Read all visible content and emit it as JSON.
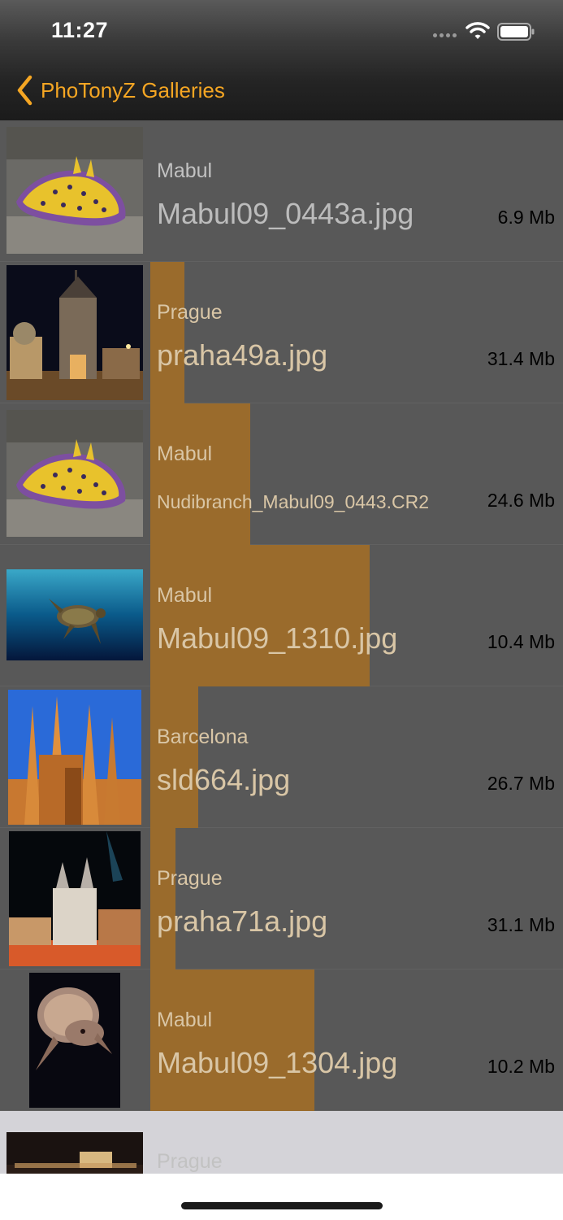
{
  "status_bar": {
    "time": "11:27"
  },
  "nav": {
    "back_label": "PhoTonyZ Galleries"
  },
  "colors": {
    "accent": "#f5a623",
    "bar": "#9a6b2c",
    "row_bg": "#585858",
    "selected_row_bg": "#d4d3d8"
  },
  "rows": [
    {
      "gallery": "Mabul",
      "filename": "Mabul09_0443a.jpg",
      "size": "6.9 Mb",
      "thumb": "nudibranch"
    },
    {
      "gallery": "Prague",
      "filename": "praha49a.jpg",
      "size": "31.4 Mb",
      "thumb": "prague-tower"
    },
    {
      "gallery": "Mabul",
      "filename": "Nudibranch_Mabul09_0443.CR2",
      "size": "24.6 Mb",
      "thumb": "nudibranch"
    },
    {
      "gallery": "Mabul",
      "filename": "Mabul09_1310.jpg",
      "size": "10.4 Mb",
      "thumb": "sea-turtle"
    },
    {
      "gallery": "Barcelona",
      "filename": "sld664.jpg",
      "size": "26.7 Mb",
      "thumb": "sagrada-familia"
    },
    {
      "gallery": "Prague",
      "filename": "praha71a.jpg",
      "size": "31.1 Mb",
      "thumb": "prague-night"
    },
    {
      "gallery": "Mabul",
      "filename": "Mabul09_1304.jpg",
      "size": "10.2 Mb",
      "thumb": "turtle-portrait"
    },
    {
      "gallery": "Prague",
      "thumb": "prague-castle"
    }
  ]
}
